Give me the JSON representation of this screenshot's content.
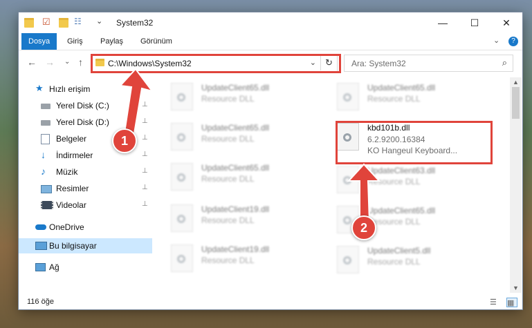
{
  "window": {
    "title": "System32",
    "controls": {
      "minimize": "—",
      "maximize": "☐",
      "close": "✕"
    }
  },
  "ribbon": {
    "tabs": [
      "Dosya",
      "Giriş",
      "Paylaş",
      "Görünüm"
    ],
    "active_tab": "Dosya",
    "expand": "⌄",
    "help": "?"
  },
  "nav": {
    "back": "←",
    "forward": "→",
    "recent": "⌄",
    "up": "↑",
    "address": "C:\\Windows\\System32",
    "address_dropdown": "⌄",
    "refresh": "↻",
    "search_placeholder": "Ara: System32",
    "search_icon": "⌕"
  },
  "sidebar": {
    "items": [
      {
        "label": "Hızlı erişim",
        "icon": "star-icon",
        "pinned": false
      },
      {
        "label": "Yerel Disk (C:)",
        "icon": "drive-icon",
        "pinned": true
      },
      {
        "label": "Yerel Disk (D:)",
        "icon": "drive-icon",
        "pinned": true
      },
      {
        "label": "Belgeler",
        "icon": "document-icon",
        "pinned": true
      },
      {
        "label": "İndirmeler",
        "icon": "download-icon",
        "pinned": true
      },
      {
        "label": "Müzik",
        "icon": "music-icon",
        "pinned": true
      },
      {
        "label": "Resimler",
        "icon": "picture-icon",
        "pinned": true
      },
      {
        "label": "Videolar",
        "icon": "video-icon",
        "pinned": true
      },
      {
        "label": "OneDrive",
        "icon": "cloud-icon",
        "pinned": false
      },
      {
        "label": "Bu bilgisayar",
        "icon": "computer-icon",
        "pinned": false,
        "selected": true
      },
      {
        "label": "Ağ",
        "icon": "network-icon",
        "pinned": false
      }
    ],
    "pin_glyph": "📌"
  },
  "files": {
    "left_column": [
      {
        "name": "UpdateClient65.dll",
        "type": "Resource DLL"
      },
      {
        "name": "UpdateClient65.dll",
        "type": "Resource DLL"
      },
      {
        "name": "UpdateClient65.dll",
        "type": "Resource DLL"
      },
      {
        "name": "UpdateClient19.dll",
        "type": "Resource DLL"
      },
      {
        "name": "UpdateClient19.dll",
        "type": "Resource DLL"
      }
    ],
    "right_column": [
      {
        "name": "UpdateClient65.dll",
        "type": "Resource DLL"
      },
      {
        "name": "UpdateClient63.dll",
        "type": "Resource DLL"
      },
      {
        "name": "UpdateClient65.dll",
        "type": "Resource DLL"
      },
      {
        "name": "UpdateClient5.dll",
        "type": "Resource DLL"
      }
    ],
    "highlighted": {
      "name": "kbd101b.dll",
      "version": "6.2.9200.16384",
      "description": "KO Hangeul Keyboard..."
    }
  },
  "status": {
    "count": "116 öğe"
  },
  "callouts": [
    "1",
    "2"
  ],
  "colors": {
    "accent": "#1979ca",
    "callout": "#e0443b",
    "selected": "#cce8ff"
  }
}
